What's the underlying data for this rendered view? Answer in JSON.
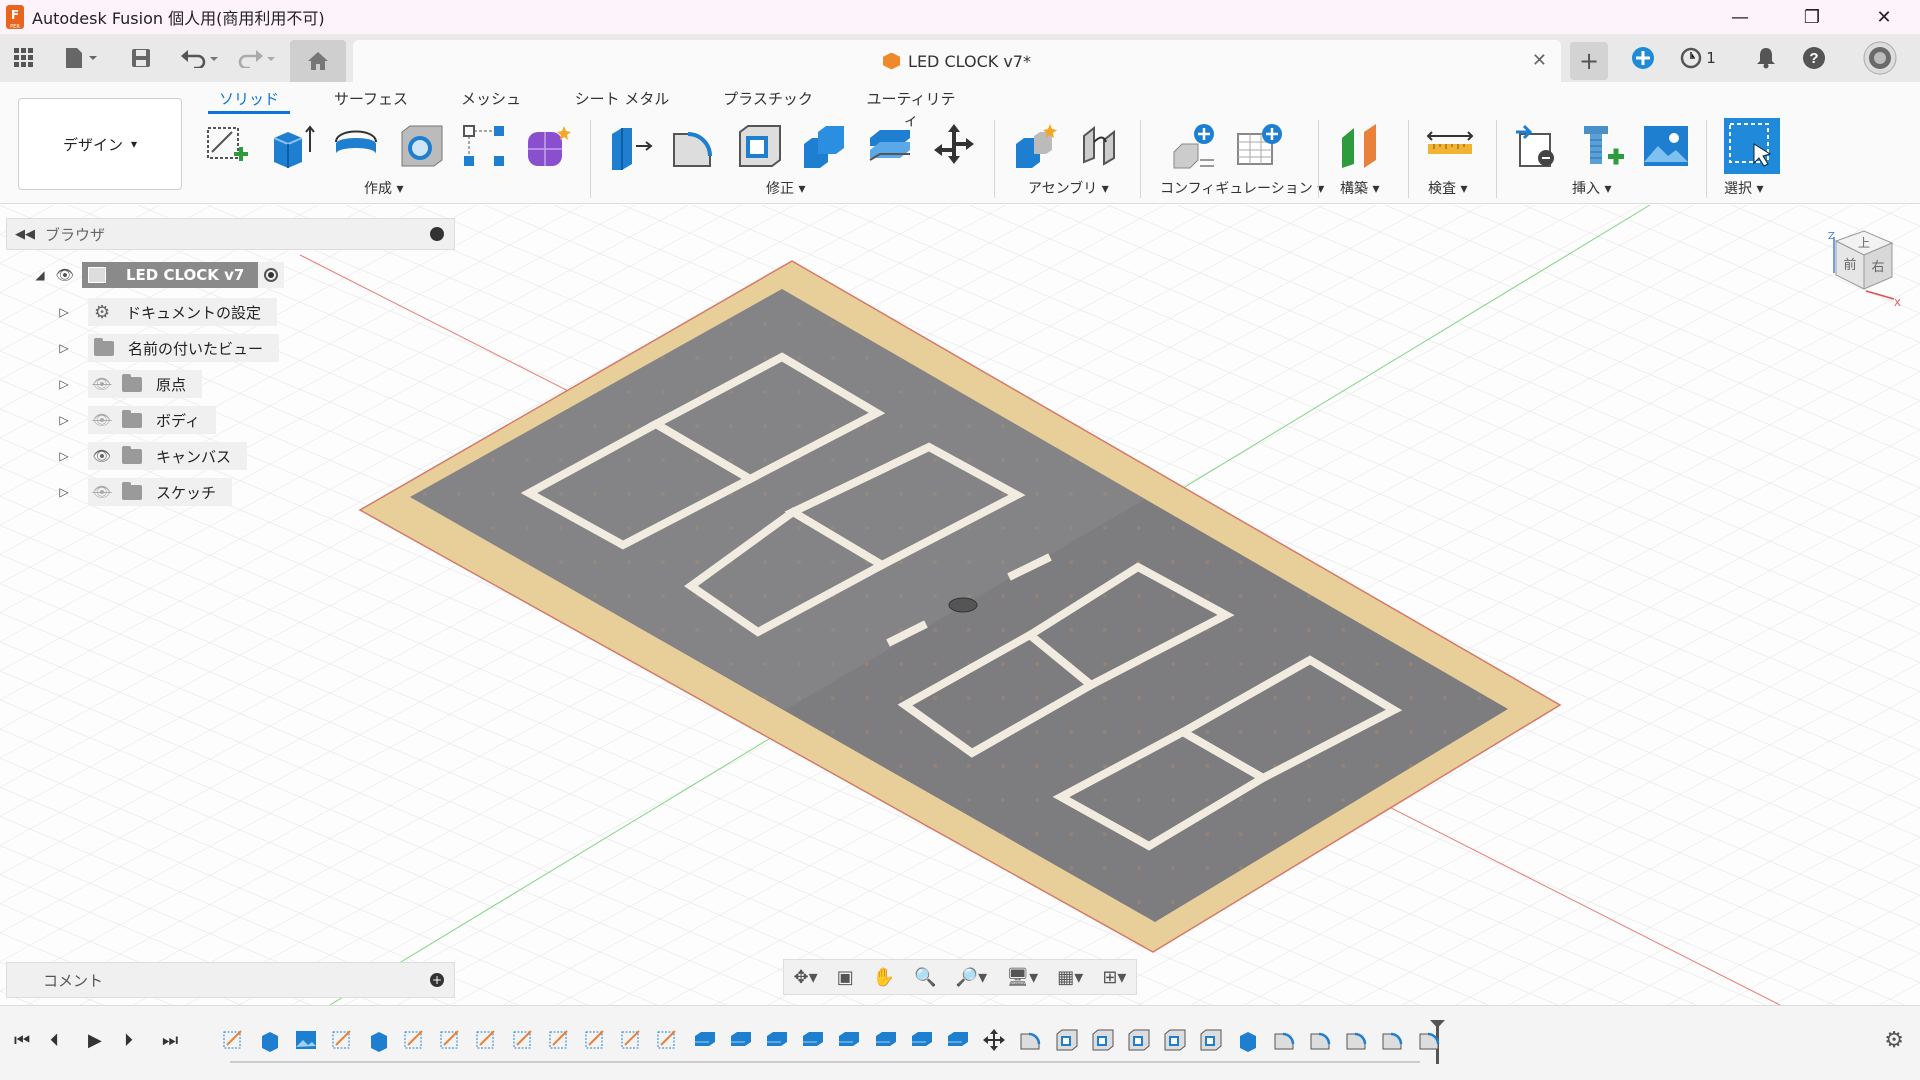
{
  "window": {
    "title": "Autodesk Fusion 個人用(商用利用不可)",
    "logo_letter": "F",
    "logo_sub": "PER",
    "minimize": "—",
    "maximize": "❐",
    "close": "✕"
  },
  "tabs": {
    "document_title": "LED CLOCK v7*",
    "close": "✕",
    "new_tab": "+",
    "job_count": "1"
  },
  "ribbon": {
    "workspace": "デザイン",
    "workspace_caret": "▾",
    "tabs": [
      "ソリッド",
      "サーフェス",
      "メッシュ",
      "シート メタル",
      "プラスチック",
      "ユーティリティ"
    ],
    "groups": {
      "create": "作成 ▾",
      "modify": "修正 ▾",
      "assemble": "アセンブリ ▾",
      "configure": "コンフィギュレーション ▾",
      "construct": "構築 ▾",
      "inspect": "検査 ▾",
      "insert": "挿入 ▾",
      "select": "選択 ▾"
    }
  },
  "browser": {
    "title": "ブラウザ",
    "root": "LED CLOCK v7",
    "items": [
      {
        "label": "ドキュメントの設定",
        "icon": "gear-icon"
      },
      {
        "label": "名前の付いたビュー",
        "icon": "folder-icon"
      },
      {
        "label": "原点",
        "icon": "folder-icon",
        "visible": false
      },
      {
        "label": "ボディ",
        "icon": "folder-icon",
        "visible": false
      },
      {
        "label": "キャンバス",
        "icon": "folder-icon",
        "visible": true
      },
      {
        "label": "スケッチ",
        "icon": "folder-icon",
        "visible": false
      }
    ]
  },
  "comments": {
    "title": "コメント"
  },
  "viewcube": {
    "top": "上",
    "front": "前",
    "right": "右",
    "z": "Z",
    "x": "X"
  },
  "colors": {
    "accent": "#0a74da",
    "board": "#7d7d80",
    "plywood": "#e8cf9a"
  }
}
